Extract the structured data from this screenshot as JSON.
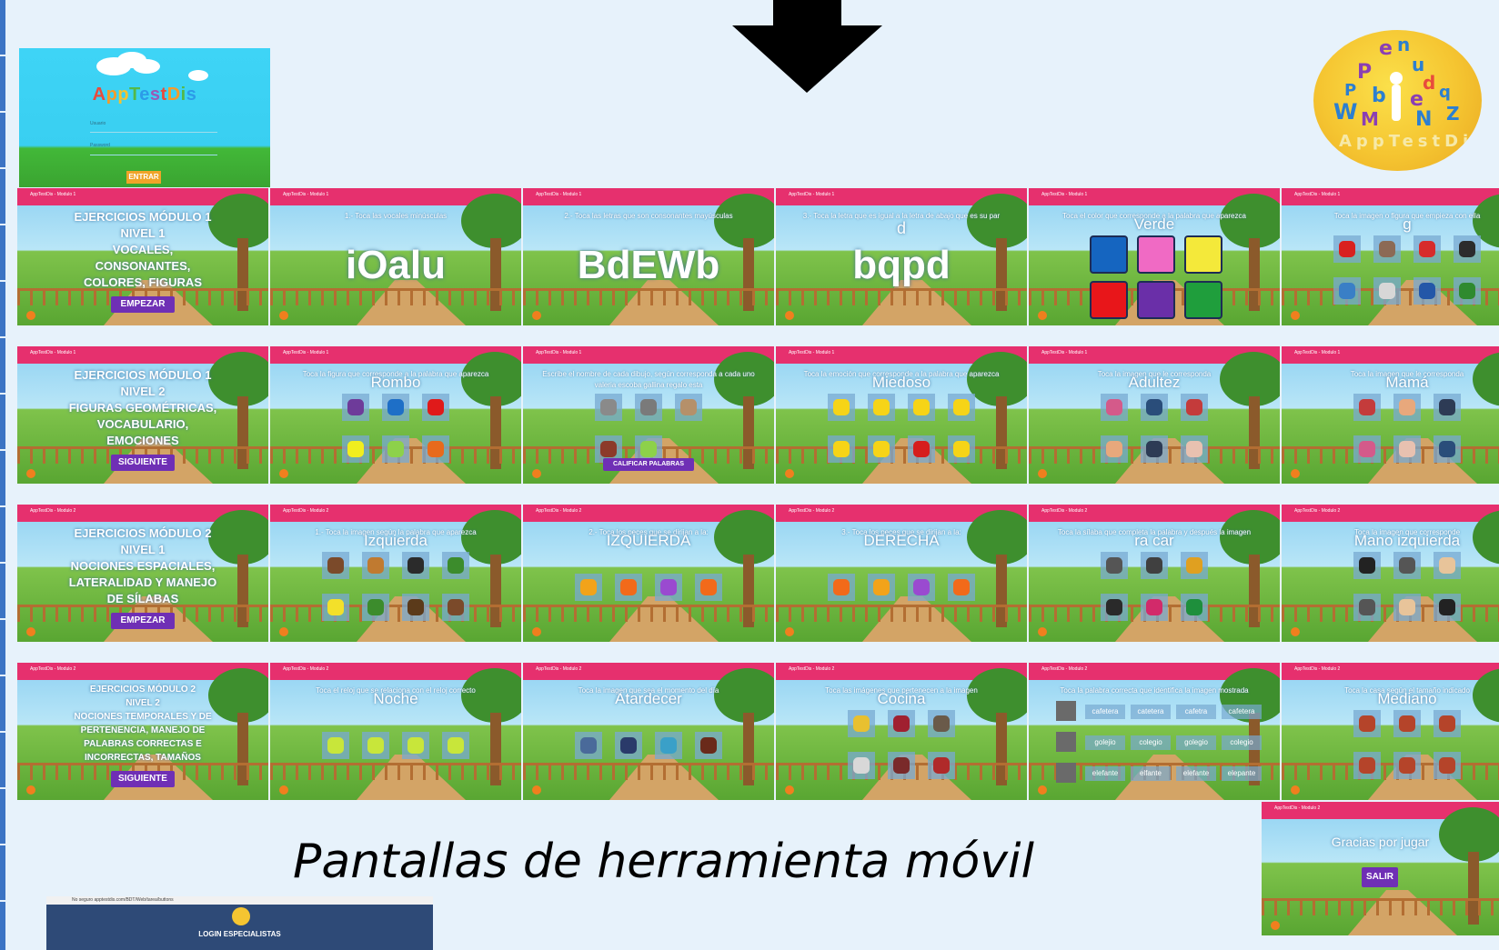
{
  "login_card": {
    "title_letters": [
      "A",
      "p",
      "p",
      "T",
      "e",
      "s",
      "t",
      "D",
      "i",
      "s"
    ],
    "title_colors": [
      "#e84b3c",
      "#f59b2a",
      "#f2c230",
      "#54b948",
      "#2c9be8",
      "#9b59b6",
      "#e84b3c",
      "#f59b2a",
      "#54b948",
      "#2c9be8"
    ],
    "field_user_label": "Usuario",
    "field_pass_label": "Password",
    "button_label": "ENTRAR"
  },
  "logo": {
    "letters": [
      "e",
      "n",
      "P",
      "u",
      "d",
      "P",
      "b",
      "e",
      "q",
      "W",
      "M",
      "N",
      "Z"
    ],
    "ring_text": "AppTestDis"
  },
  "tiles": [
    {
      "bar": "AppTestDis - Modulo 1",
      "kind": "intro",
      "title_lines": [
        "EJERCICIOS MÓDULO 1",
        "NIVEL 1",
        "VOCALES,",
        "CONSONANTES,",
        "COLORES, FIGURAS"
      ],
      "button": "EMPEZAR"
    },
    {
      "bar": "AppTestDis - Modulo 1",
      "kind": "letters",
      "heading": "1.- Toca las vocales minúsculas",
      "big": "iOalu"
    },
    {
      "bar": "AppTestDis - Modulo 1",
      "kind": "letters",
      "heading": "2.- Toca las letras que son consonantes mayúsculas",
      "big": "BdEWb"
    },
    {
      "bar": "AppTestDis - Modulo 1",
      "kind": "letters",
      "heading": "3.- Toca la letra que es igual a la letra de abajo que es su par",
      "sub": "d",
      "big": "bqpd"
    },
    {
      "bar": "AppTestDis - Modulo 1",
      "kind": "colors",
      "heading": "Toca el color que corresponde a la palabra que aparezca",
      "word": "Verde",
      "swatches": [
        "#1565c0",
        "#f06ac4",
        "#f4e93a",
        "#e8161a",
        "#6a2fa8",
        "#1f9e3c"
      ]
    },
    {
      "bar": "AppTestDis - Modulo 1",
      "kind": "icons",
      "heading": "Toca la imagen o figura que empieza con ella",
      "word": "g",
      "colors": [
        "#d9201f",
        "#8c6a55",
        "#d72b2b",
        "#2c2c2c",
        "#3a7fc6",
        "#d7d7d7",
        "#2457a8",
        "#2f8a2f"
      ]
    },
    {
      "bar": "AppTestDis - Modulo 1",
      "kind": "intro",
      "title_lines": [
        "EJERCICIOS MÓDULO 1",
        "NIVEL 2",
        "FIGURAS GEOMÉTRICAS,",
        "VOCABULARIO,",
        "EMOCIONES"
      ],
      "button": "SIGUIENTE"
    },
    {
      "bar": "AppTestDis - Modulo 1",
      "kind": "icons",
      "heading": "Toca la figura que corresponde a la palabra que aparezca",
      "word": "Rombo",
      "colors": [
        "#6e3b9a",
        "#1e6fc7",
        "#e01a1a",
        "#f1ee1e",
        "#8dd14a",
        "#e86a1c"
      ]
    },
    {
      "bar": "AppTestDis - Modulo 1",
      "kind": "words",
      "heading": "Escribe el nombre de cada dibujo, según corresponda a cada uno",
      "sub": "valeria escoba gallina regalo esta",
      "colors": [
        "#8a8a8a",
        "#7a7a7a",
        "#b5906a",
        "#8c3a2a",
        "#8dd14a"
      ],
      "button": "CALIFICAR PALABRAS"
    },
    {
      "bar": "AppTestDis - Modulo 1",
      "kind": "icons",
      "heading": "Toca la emoción que corresponde a la palabra que aparezca",
      "word": "Miedoso",
      "colors": [
        "#f6d417",
        "#f6d417",
        "#f6d417",
        "#f6d417",
        "#f6d417",
        "#f6d417",
        "#d61d1d",
        "#f6d417"
      ]
    },
    {
      "bar": "AppTestDis - Modulo 1",
      "kind": "icons",
      "heading": "Toca la imagen que le corresponda",
      "word": "Adultez",
      "colors": [
        "#d45a8a",
        "#2a4d7a",
        "#c43b3b",
        "#e8a87c",
        "#2d3b55",
        "#e8c1b0"
      ]
    },
    {
      "bar": "AppTestDis - Modulo 1",
      "kind": "icons",
      "heading": "Toca la imagen que le corresponda",
      "word": "Mamá",
      "colors": [
        "#c43b3b",
        "#e8a87c",
        "#2d3b55",
        "#d45a8a",
        "#e8c1b0",
        "#2a4d7a"
      ]
    },
    {
      "bar": "AppTestDis - Modulo 2",
      "kind": "intro",
      "title_lines": [
        "EJERCICIOS MÓDULO 2",
        "NIVEL 1",
        "NOCIONES ESPACIALES,",
        "LATERALIDAD Y MANEJO",
        "DE SÍLABAS"
      ],
      "button": "EMPEZAR"
    },
    {
      "bar": "AppTestDis - Modulo 2",
      "kind": "icons",
      "heading": "1.- Toca la imagen según la palabra que aparezca",
      "word": "Izquierda",
      "colors": [
        "#7b4a2a",
        "#c07a30",
        "#2b2b2b",
        "#3c8c2c",
        "#f3e02a",
        "#3c8c2c",
        "#5b3a1a",
        "#7b4a2a"
      ]
    },
    {
      "bar": "AppTestDis - Modulo 2",
      "kind": "icons",
      "heading": "2.- Toca los peces que se dirijan a la:",
      "word": "IZQUIERDA",
      "colors": [
        "#f2a31a",
        "#f26a1a",
        "#9a4ad0",
        "#f26a1a"
      ]
    },
    {
      "bar": "AppTestDis - Modulo 2",
      "kind": "icons",
      "heading": "3.- Toca los peces que se dirijan a la:",
      "word": "DERECHA",
      "colors": [
        "#f26a1a",
        "#f2a31a",
        "#9a4ad0",
        "#f26a1a"
      ]
    },
    {
      "bar": "AppTestDis - Modulo 2",
      "kind": "icons",
      "heading": "Toca la sílaba que completa la palabra y después la imagen",
      "word": "ra   car",
      "colors": [
        "#555555",
        "#404040",
        "#e0a020",
        "#2a2a2a",
        "#d22a6a",
        "#1e8f3c"
      ]
    },
    {
      "bar": "AppTestDis - Modulo 2",
      "kind": "icons",
      "heading": "Toca la imagen que corresponde",
      "word": "Mano izquierda",
      "colors": [
        "#222222",
        "#555555",
        "#e8c49a",
        "#555555",
        "#e8c49a",
        "#222222"
      ]
    },
    {
      "bar": "AppTestDis - Modulo 2",
      "kind": "intro",
      "title_lines": [
        "EJERCICIOS MÓDULO 2",
        "NIVEL 2",
        "NOCIONES TEMPORALES Y DE",
        "PERTENENCIA, MANEJO DE",
        "PALABRAS CORRECTAS E",
        "INCORRECTAS, TAMAÑOS"
      ],
      "button": "SIGUIENTE"
    },
    {
      "bar": "AppTestDis - Modulo 2",
      "kind": "icons",
      "heading": "Toca el reloj que se relaciona con el reloj correcto",
      "word": "Noche",
      "colors": [
        "#c8e63a",
        "#c8e63a",
        "#c8e63a",
        "#c8e63a"
      ]
    },
    {
      "bar": "AppTestDis - Modulo 2",
      "kind": "icons",
      "heading": "Toca la imagen que sea el momento del día",
      "word": "Atardecer",
      "colors": [
        "#4a6a9a",
        "#2a3a6a",
        "#3aa0c8",
        "#6a2a1a"
      ]
    },
    {
      "bar": "AppTestDis - Modulo 2",
      "kind": "icons",
      "heading": "Toca las imágenes que pertenecen a la imagen",
      "word": "Cocina",
      "colors": [
        "#e8c030",
        "#a02030",
        "#6a5a4a",
        "#d8d8d8",
        "#7a2a2a",
        "#b02a2a"
      ]
    },
    {
      "bar": "AppTestDis - Modulo 2",
      "kind": "choices",
      "heading": "Toca la palabra correcta que identifica la imagen mostrada",
      "rows": [
        [
          "cafetera",
          "catetera",
          "cafetra",
          "cafetera"
        ],
        [
          "golejio",
          "colegio",
          "golegio",
          "colegio"
        ],
        [
          "elefante",
          "elfante",
          "elefante",
          "elepante"
        ]
      ]
    },
    {
      "bar": "AppTestDis - Modulo 2",
      "kind": "icons",
      "heading": "Toca la casa según el tamaño indicado",
      "word": "Mediano",
      "colors": [
        "#b5442a",
        "#b5442a",
        "#b5442a",
        "#b5442a",
        "#b5442a",
        "#b5442a"
      ]
    },
    {
      "bar": "AppTestDis - Modulo 2",
      "kind": "end",
      "heading": "Gracias por jugar",
      "button": "SALIR"
    }
  ],
  "caption": "Pantallas de herramienta móvil",
  "bottom_screenshot": {
    "url_text": "No seguro   apptestdis.com/BDT/Web/tarea/buttons",
    "title": "LOGIN ESPECIALISTAS"
  }
}
